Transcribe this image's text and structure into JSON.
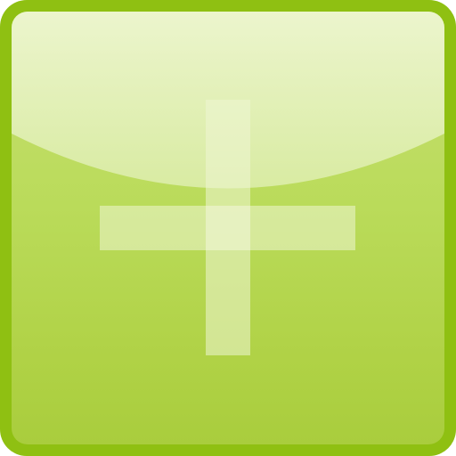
{
  "button": {
    "action": "add",
    "icon": "plus-icon",
    "style": "glossy-square"
  },
  "colors": {
    "border": "#8fc012",
    "face_top": "#c6df72",
    "face_bottom": "#a9cd3d",
    "gloss": "#eef6d2",
    "plus": "#eef5d4"
  }
}
